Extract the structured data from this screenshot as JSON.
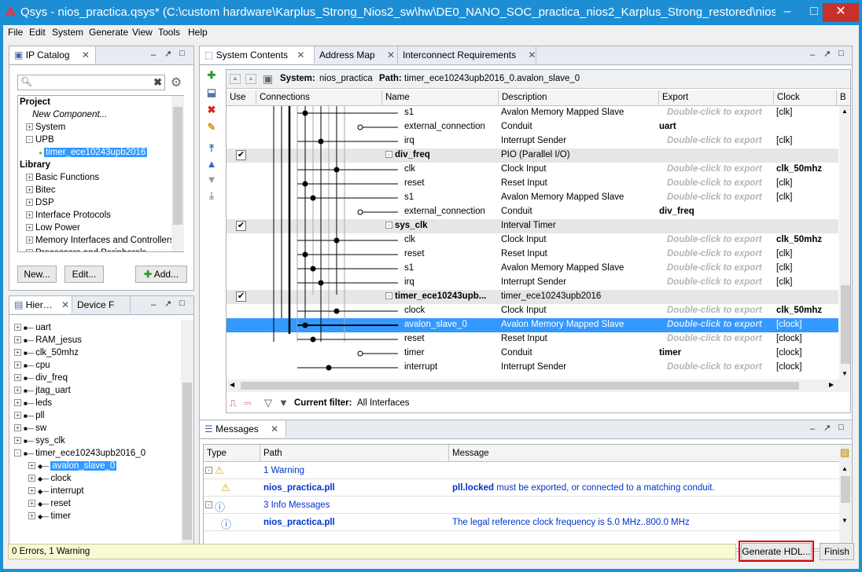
{
  "window": {
    "title": "Qsys - nios_practica.qsys* (C:\\custom hardware\\Karplus_Strong_Nios2_sw\\hw\\DE0_NANO_SOC_practica_nios2_Karplus_Strong_restored\\nios_pra...",
    "min": "–",
    "max": "□",
    "close": "✕"
  },
  "menu": [
    "File",
    "Edit",
    "System",
    "Generate",
    "View",
    "Tools",
    "Help"
  ],
  "ip_catalog": {
    "tab": "IP Catalog",
    "search_placeholder": "",
    "tree": [
      {
        "label": "Project",
        "bold": true,
        "indent": 0
      },
      {
        "label": "New Component...",
        "italic": true,
        "indent": 2
      },
      {
        "label": "System",
        "indent": 1,
        "exp": "+"
      },
      {
        "label": "UPB",
        "indent": 1,
        "exp": "-"
      },
      {
        "label": "timer_ece10243upb2016",
        "indent": 3,
        "selected": true
      },
      {
        "label": "Library",
        "bold": true,
        "indent": 0
      },
      {
        "label": "Basic Functions",
        "indent": 1,
        "exp": "+"
      },
      {
        "label": "Bitec",
        "indent": 1,
        "exp": "+"
      },
      {
        "label": "DSP",
        "indent": 1,
        "exp": "+"
      },
      {
        "label": "Interface Protocols",
        "indent": 1,
        "exp": "+"
      },
      {
        "label": "Low Power",
        "indent": 1,
        "exp": "+"
      },
      {
        "label": "Memory Interfaces and Controllers",
        "indent": 1,
        "exp": "+"
      },
      {
        "label": "Processors and Peripherals",
        "indent": 1,
        "exp": "+"
      }
    ],
    "buttons": {
      "new": "New...",
      "edit": "Edit...",
      "add": "Add..."
    }
  },
  "hier": {
    "tabs": [
      "Hier…",
      "Device F"
    ],
    "tree": [
      {
        "label": "uart",
        "indent": 0
      },
      {
        "label": "RAM_jesus",
        "indent": 0
      },
      {
        "label": "clk_50mhz",
        "indent": 0
      },
      {
        "label": "cpu",
        "indent": 0
      },
      {
        "label": "div_freq",
        "indent": 0
      },
      {
        "label": "jtag_uart",
        "indent": 0
      },
      {
        "label": "leds",
        "indent": 0
      },
      {
        "label": "pll",
        "indent": 0
      },
      {
        "label": "sw",
        "indent": 0
      },
      {
        "label": "sys_clk",
        "indent": 0
      },
      {
        "label": "timer_ece10243upb2016_0",
        "indent": 0,
        "open": true
      },
      {
        "label": "avalon_slave_0",
        "indent": 1,
        "selected": true
      },
      {
        "label": "clock",
        "indent": 1
      },
      {
        "label": "interrupt",
        "indent": 1
      },
      {
        "label": "reset",
        "indent": 1
      },
      {
        "label": "timer",
        "indent": 1
      }
    ]
  },
  "system_contents": {
    "tabs": [
      "System Contents",
      "Address Map",
      "Interconnect Requirements"
    ],
    "system_label": "System:",
    "system_name": "nios_practica",
    "path_label": "Path:",
    "path": "timer_ece10243upb2016_0.avalon_slave_0",
    "columns": [
      "Use",
      "Connections",
      "Name",
      "Description",
      "Export",
      "Clock",
      "B"
    ],
    "rows": [
      {
        "name": "s1",
        "desc": "Avalon Memory Mapped Slave",
        "export": "Double-click to export",
        "clock": "[clk]"
      },
      {
        "name": "external_connection",
        "desc": "Conduit",
        "export": "uart",
        "clock": ""
      },
      {
        "name": "irq",
        "desc": "Interrupt Sender",
        "export": "Double-click to export",
        "clock": "[clk]"
      },
      {
        "name": "div_freq",
        "desc": "PIO (Parallel I/O)",
        "export": "",
        "clock": "",
        "group": true,
        "checked": true
      },
      {
        "name": "clk",
        "desc": "Clock Input",
        "export": "Double-click to export",
        "clock": "clk_50mhz",
        "clockBold": true
      },
      {
        "name": "reset",
        "desc": "Reset Input",
        "export": "Double-click to export",
        "clock": "[clk]"
      },
      {
        "name": "s1",
        "desc": "Avalon Memory Mapped Slave",
        "export": "Double-click to export",
        "clock": "[clk]"
      },
      {
        "name": "external_connection",
        "desc": "Conduit",
        "export": "div_freq",
        "clock": ""
      },
      {
        "name": "sys_clk",
        "desc": "Interval Timer",
        "export": "",
        "clock": "",
        "group": true,
        "checked": true
      },
      {
        "name": "clk",
        "desc": "Clock Input",
        "export": "Double-click to export",
        "clock": "clk_50mhz",
        "clockBold": true
      },
      {
        "name": "reset",
        "desc": "Reset Input",
        "export": "Double-click to export",
        "clock": "[clk]"
      },
      {
        "name": "s1",
        "desc": "Avalon Memory Mapped Slave",
        "export": "Double-click to export",
        "clock": "[clk]"
      },
      {
        "name": "irq",
        "desc": "Interrupt Sender",
        "export": "Double-click to export",
        "clock": "[clk]"
      },
      {
        "name": "timer_ece10243upb...",
        "desc": "timer_ece10243upb2016",
        "export": "",
        "clock": "",
        "group": true,
        "checked": true
      },
      {
        "name": "clock",
        "desc": "Clock Input",
        "export": "Double-click to export",
        "clock": "clk_50mhz",
        "clockBold": true
      },
      {
        "name": "avalon_slave_0",
        "desc": "Avalon Memory Mapped Slave",
        "export": "Double-click to export",
        "clock": "[clock]",
        "selected": true
      },
      {
        "name": "reset",
        "desc": "Reset Input",
        "export": "Double-click to export",
        "clock": "[clock]"
      },
      {
        "name": "timer",
        "desc": "Conduit",
        "export": "timer",
        "clock": "[clock]"
      },
      {
        "name": "interrupt",
        "desc": "Interrupt Sender",
        "export": "Double-click to export",
        "clock": "[clock]"
      }
    ],
    "filter_label": "Current filter:",
    "filter_value": "All Interfaces"
  },
  "messages": {
    "tab": "Messages",
    "columns": [
      "Type",
      "Path",
      "Message"
    ],
    "rows": [
      {
        "type": "warning-group",
        "path": "1 Warning",
        "message": ""
      },
      {
        "type": "warning",
        "path": "nios_practica.pll",
        "msg_bold": "pll.locked",
        "message": " must be exported, or connected to a matching conduit."
      },
      {
        "type": "info-group",
        "path": "3 Info Messages",
        "message": ""
      },
      {
        "type": "info",
        "path": "nios_practica.pll",
        "msg_bold": "",
        "message": "The legal reference clock frequency is 5.0 MHz..800.0 MHz"
      }
    ]
  },
  "status": {
    "text": "0 Errors, 1 Warning",
    "generate": "Generate HDL...",
    "finish": "Finish"
  },
  "colors": {
    "title_bar": "#1e8ed4",
    "selection": "#3399ff",
    "highlight_border": "#e00000"
  }
}
